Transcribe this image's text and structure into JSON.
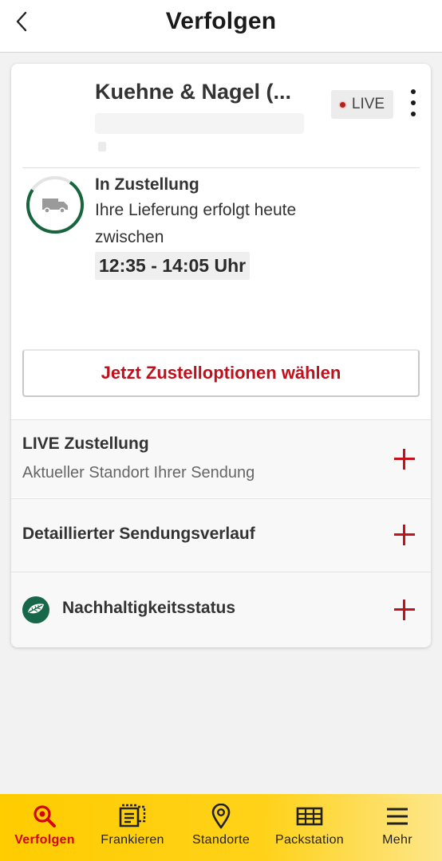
{
  "header": {
    "title": "Verfolgen"
  },
  "shipment": {
    "carrier": "Kuehne & Nagel (...",
    "live_badge": "LIVE",
    "status_title": "In Zustellung",
    "status_desc": "Ihre Lieferung erfolgt heute zwischen",
    "time_window": "12:35 - 14:05 Uhr",
    "progress_color": "#17653e",
    "cta_label": "Jetzt Zustelloptionen wählen"
  },
  "sections": {
    "live": {
      "title": "LIVE Zustellung",
      "subtitle": "Aktueller Standort Ihrer Sendung"
    },
    "history": {
      "title": "Detaillierter Sendungsverlauf"
    },
    "sustainability": {
      "title": "Nachhaltigkeitsstatus",
      "icon": "leaf-icon"
    }
  },
  "tabbar": {
    "tabs": [
      {
        "label": "Verfolgen",
        "icon": "search-icon",
        "active": true
      },
      {
        "label": "Frankieren",
        "icon": "stamp-icon",
        "active": false
      },
      {
        "label": "Standorte",
        "icon": "location-pin-icon",
        "active": false
      },
      {
        "label": "Packstation",
        "icon": "packstation-icon",
        "active": false
      },
      {
        "label": "Mehr",
        "icon": "menu-icon",
        "active": false
      }
    ]
  },
  "colors": {
    "accent_red": "#d40511",
    "brand_yellow": "#ffcc00",
    "green": "#17684a"
  }
}
